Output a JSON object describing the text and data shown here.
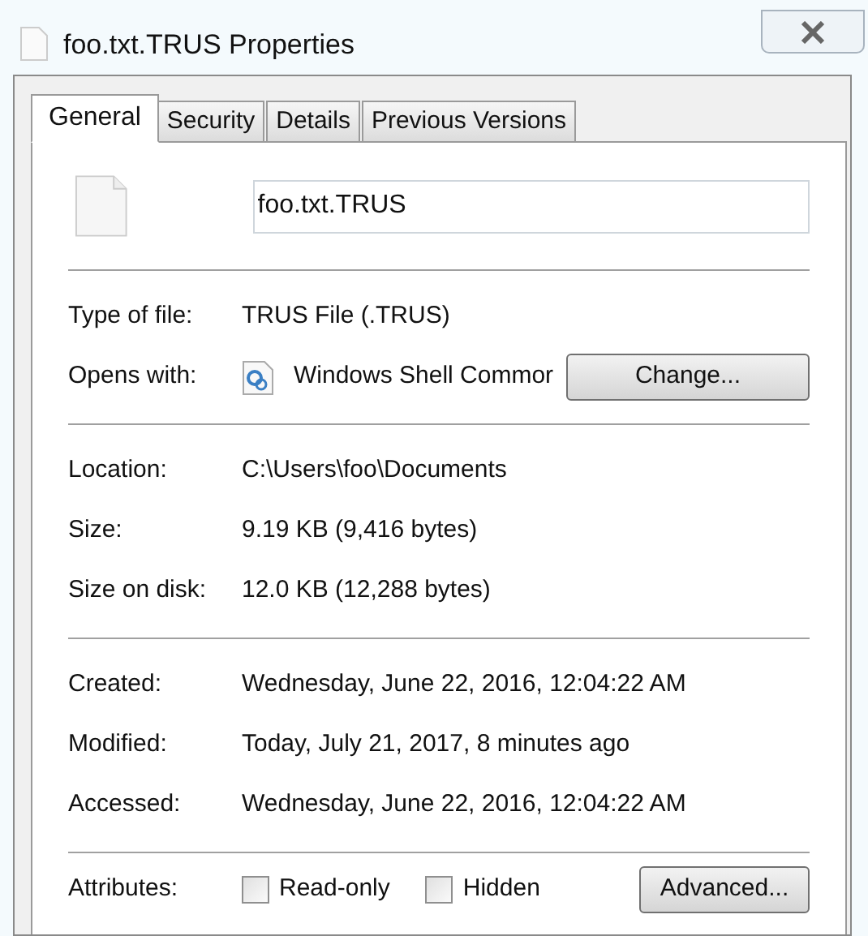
{
  "window": {
    "title": "foo.txt.TRUS Properties"
  },
  "tabs": [
    {
      "label": "General",
      "selected": true
    },
    {
      "label": "Security",
      "selected": false
    },
    {
      "label": "Details",
      "selected": false
    },
    {
      "label": "Previous Versions",
      "selected": false
    }
  ],
  "file_name": {
    "value": "foo.txt.TRUS"
  },
  "sections": [
    [
      {
        "kind": "text",
        "label": "Type of file:",
        "value": "TRUS File (.TRUS)"
      },
      {
        "kind": "app",
        "label": "Opens with:",
        "value": "Windows Shell Commor",
        "button": "Change..."
      }
    ],
    [
      {
        "kind": "text",
        "label": "Location:",
        "value": "C:\\Users\\foo\\Documents"
      },
      {
        "kind": "text",
        "label": "Size:",
        "value": "9.19 KB (9,416 bytes)"
      },
      {
        "kind": "text",
        "label": "Size on disk:",
        "value": "12.0 KB (12,288 bytes)"
      }
    ],
    [
      {
        "kind": "text",
        "label": "Created:",
        "value": "Wednesday, June 22, 2016, 12:04:22 AM"
      },
      {
        "kind": "text",
        "label": "Modified:",
        "value": "Today, July 21, 2017, 8 minutes ago"
      },
      {
        "kind": "text",
        "label": "Accessed:",
        "value": "Wednesday, June 22, 2016, 12:04:22 AM"
      }
    ]
  ],
  "attributes": {
    "label": "Attributes:",
    "checkboxes": [
      {
        "label": "Read-only",
        "checked": false
      },
      {
        "label": "Hidden",
        "checked": false
      }
    ],
    "button": "Advanced..."
  }
}
